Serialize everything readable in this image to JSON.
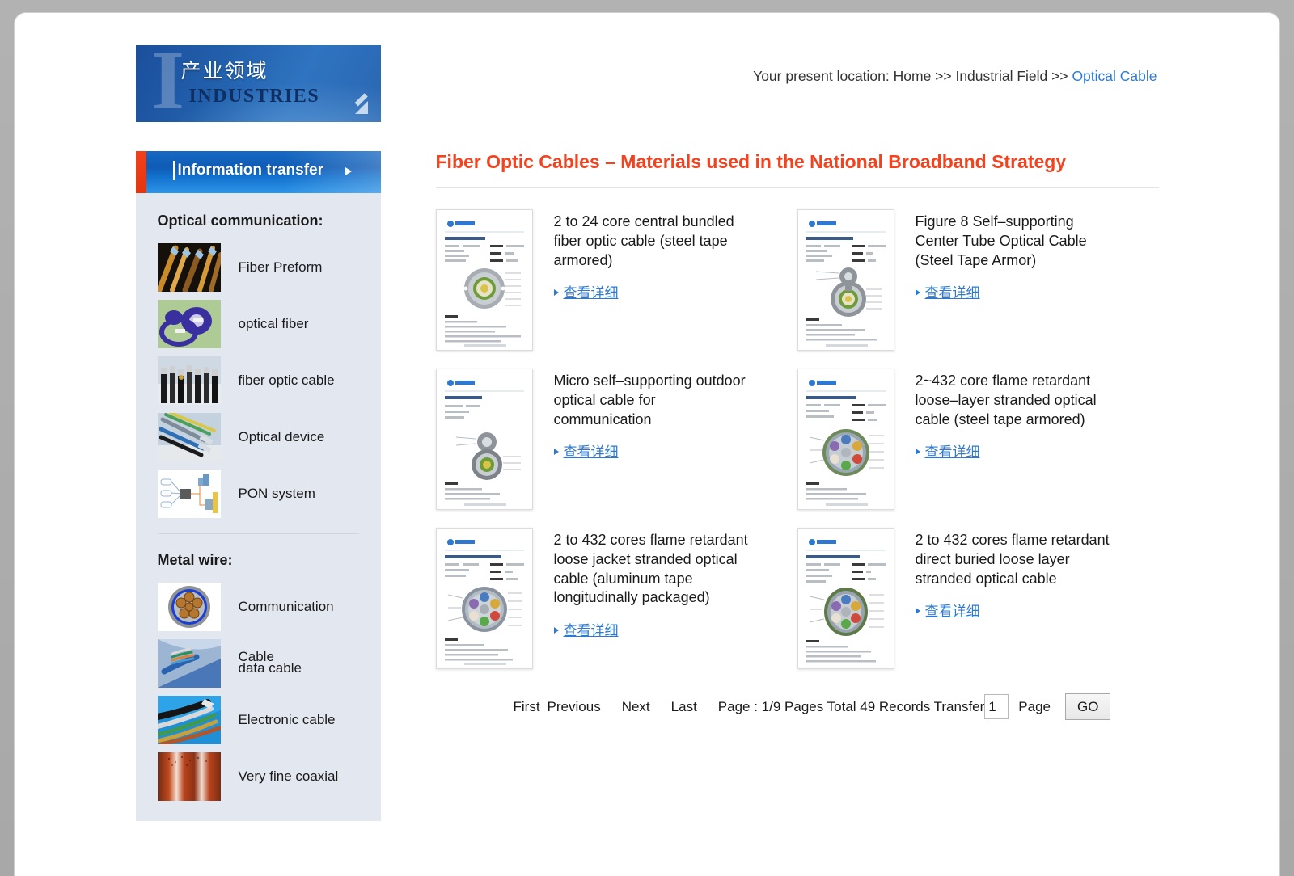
{
  "banner": {
    "big_letter": "I",
    "title_cn": "产业领域",
    "title_en": "INDUSTRIES",
    "arrow_icon": "arrow-down-right-icon"
  },
  "breadcrumb": {
    "prefix": "Your present location: Home >> Industrial Field >> ",
    "current": "Optical Cable"
  },
  "sidebar": {
    "header": {
      "label": "Information transfer",
      "arrow_icon": "chevron-right-icon",
      "accent_color": "#e5360f"
    },
    "groups": [
      {
        "title": "Optical communication:",
        "items": [
          {
            "label": "Fiber Preform",
            "thumb": "fiber-preform-thumb"
          },
          {
            "label": "optical fiber",
            "thumb": "optical-fiber-thumb"
          },
          {
            "label": "fiber optic cable",
            "thumb": "fiber-optic-cable-thumb"
          },
          {
            "label": "Optical device",
            "thumb": "optical-device-thumb"
          },
          {
            "label": "PON system",
            "thumb": "pon-system-thumb"
          }
        ]
      },
      {
        "title": "Metal wire:",
        "items": [
          {
            "label": "Communication",
            "thumb": "communication-cable-thumb"
          },
          {
            "label": "Cable",
            "label2": "data cable",
            "thumb": "data-cable-thumb"
          },
          {
            "label": "Electronic cable",
            "thumb": "electronic-cable-thumb"
          },
          {
            "label": "Very fine coaxial",
            "thumb": "coaxial-thumb"
          }
        ]
      }
    ]
  },
  "main": {
    "title": "Fiber Optic Cables – Materials used in the National Broadband Strategy",
    "detail_link_label": "查看详细",
    "products": [
      {
        "name": "2 to 24 core central bundled fiber optic cable (steel tape armored)",
        "thumb": "datasheet-round-cable"
      },
      {
        "name": "Figure 8 Self–supporting Center Tube Optical Cable (Steel Tape Armor)",
        "thumb": "datasheet-figure8-cable"
      },
      {
        "name": "Micro self–supporting outdoor optical cable for communication",
        "thumb": "datasheet-micro-figure8-cable"
      },
      {
        "name": "2~432 core flame retardant loose–layer stranded optical cable (steel tape armored)",
        "thumb": "datasheet-stranded-cable"
      },
      {
        "name": "2 to 432 cores flame retardant loose jacket stranded optical cable (aluminum tape longitudinally packaged)",
        "thumb": "datasheet-loose-jacket-cable"
      },
      {
        "name": "2 to 432 cores flame retardant direct buried loose layer stranded optical cable",
        "thumb": "datasheet-direct-buried-cable"
      }
    ]
  },
  "pager": {
    "first": "First",
    "previous": "Previous",
    "next": "Next",
    "last": "Last",
    "status": "Page : 1/9 Pages Total 49 Records Transfer",
    "page_value": "1",
    "page_suffix": "Page",
    "go": "GO"
  }
}
